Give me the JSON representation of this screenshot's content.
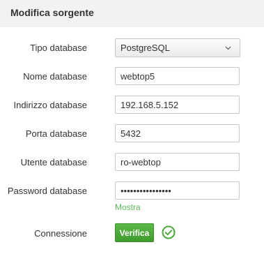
{
  "dialog": {
    "title": "Modifica sorgente"
  },
  "form": {
    "db_type": {
      "label": "Tipo database",
      "value": "PostgreSQL"
    },
    "db_name": {
      "label": "Nome database",
      "value": "webtop5"
    },
    "db_address": {
      "label": "Indirizzo database",
      "value": "192.168.5.152"
    },
    "db_port": {
      "label": "Porta database",
      "value": "5432"
    },
    "db_user": {
      "label": "Utente database",
      "value": "ro-webtop"
    },
    "db_password": {
      "label": "Password database",
      "value": "••••••••••••••••",
      "show_link": "Mostra"
    },
    "connection": {
      "label": "Connessione",
      "verify_button": "Verifica",
      "status_icon": "check-circle-icon"
    }
  },
  "colors": {
    "accent_green": "#5cb85c",
    "button_green": "#4aa839",
    "header_bg": "#f2f2f2"
  }
}
